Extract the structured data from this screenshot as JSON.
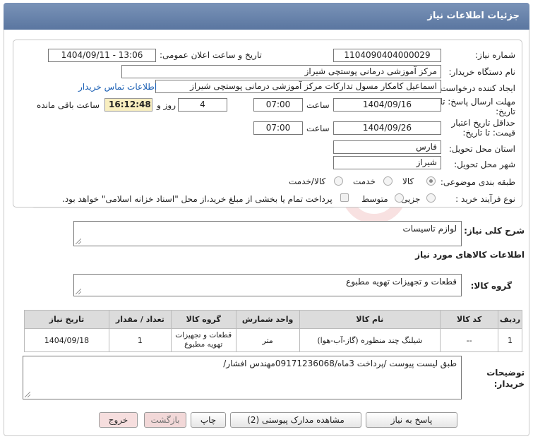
{
  "header": {
    "title": "جزئیات اطلاعات نیاز"
  },
  "form": {
    "need_number_label": "شماره نیاز:",
    "need_number": "1104090404000029",
    "announce_label": "تاریخ و ساعت اعلان عمومی:",
    "announce_value": "1404/09/11 - 13:06",
    "buyer_org_label": "نام دستگاه خریدار:",
    "buyer_org": "مرکز آموزشی درمانی پوستچی شیراز",
    "creator_label": "ایجاد کننده درخواست:",
    "creator": "اسماعیل کامکار مسول تدارکات مرکز آموزشی درمانی پوستچی شیراز",
    "contact_link": "اطلاعات تماس خریدار",
    "deadline_label_1": "مهلت ارسال پاسخ: تا",
    "deadline_label_2": "تاریخ:",
    "deadline_date": "1404/09/16",
    "time_label": "ساعت",
    "deadline_time": "07:00",
    "days_value": "4",
    "days_label": "روز و",
    "remaining_time": "16:12:48",
    "remaining_label": "ساعت باقی مانده",
    "validity_label_1": "حداقل تاریخ اعتبار",
    "validity_label_2": "قیمت: تا تاریخ:",
    "validity_date": "1404/09/26",
    "validity_time": "07:00",
    "province_label": "استان محل تحویل:",
    "province": "فارس",
    "city_label": "شهر محل تحویل:",
    "city": "شیراز",
    "category_label": "طبقه بندی موضوعی:",
    "category_options": [
      "کالا",
      "خدمت",
      "کالا/خدمت"
    ],
    "category_selected": "کالا",
    "process_label": "نوع فرآیند خرید :",
    "process_options": [
      "جزیی",
      "متوسط"
    ],
    "payment_note": "پرداخت تمام یا بخشی از مبلغ خرید،از محل \"اسناد خزانه اسلامی\" خواهد بود."
  },
  "description": {
    "label": "شرح کلی نیاز:",
    "value": "لوازم تاسیسات"
  },
  "goods": {
    "section_title": "اطلاعات کالاهای مورد نیاز",
    "group_label": "گروه کالا:",
    "group_value": "قطعات و تجهیزات تهویه مطبوع",
    "columns": [
      "ردیف",
      "کد کالا",
      "نام کالا",
      "واحد شمارش",
      "گروه کالا",
      "تعداد / مقدار",
      "تاریخ نیاز"
    ],
    "rows": [
      [
        "1",
        "--",
        "شیلنگ چند منظوره (گاز-آب-هوا)",
        "متر",
        "قطعات و تجهیزات تهویه مطبوع",
        "1",
        "1404/09/18"
      ]
    ]
  },
  "buyer_notes": {
    "label_1": "توضیحات",
    "label_2": "خریدار:",
    "value": "طبق لیست پیوست /پرداخت 3ماه/09171236068مهندس افشار/"
  },
  "buttons": {
    "reply": "پاسخ به نیاز",
    "docs": "مشاهده مدارک پیوستی (2)",
    "print": "چاپ",
    "back": "بازگشت",
    "exit": "خروج"
  },
  "colors": {
    "header_bg": "#6a84ab",
    "remaining_bg": "#f8eec0",
    "link": "#1a5fb4"
  }
}
